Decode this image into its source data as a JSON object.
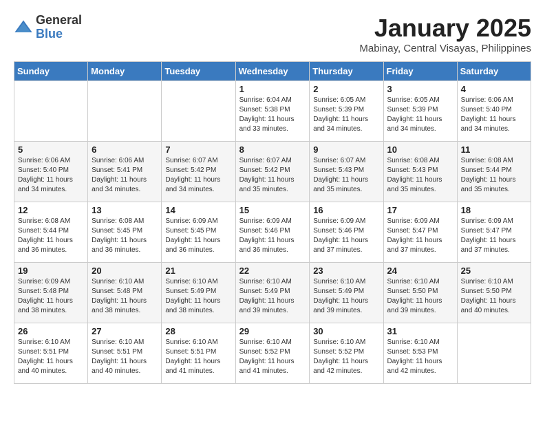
{
  "header": {
    "logo_general": "General",
    "logo_blue": "Blue",
    "title": "January 2025",
    "location": "Mabinay, Central Visayas, Philippines"
  },
  "weekdays": [
    "Sunday",
    "Monday",
    "Tuesday",
    "Wednesday",
    "Thursday",
    "Friday",
    "Saturday"
  ],
  "weeks": [
    [
      {
        "day": "",
        "info": ""
      },
      {
        "day": "",
        "info": ""
      },
      {
        "day": "",
        "info": ""
      },
      {
        "day": "1",
        "info": "Sunrise: 6:04 AM\nSunset: 5:38 PM\nDaylight: 11 hours\nand 33 minutes."
      },
      {
        "day": "2",
        "info": "Sunrise: 6:05 AM\nSunset: 5:39 PM\nDaylight: 11 hours\nand 34 minutes."
      },
      {
        "day": "3",
        "info": "Sunrise: 6:05 AM\nSunset: 5:39 PM\nDaylight: 11 hours\nand 34 minutes."
      },
      {
        "day": "4",
        "info": "Sunrise: 6:06 AM\nSunset: 5:40 PM\nDaylight: 11 hours\nand 34 minutes."
      }
    ],
    [
      {
        "day": "5",
        "info": "Sunrise: 6:06 AM\nSunset: 5:40 PM\nDaylight: 11 hours\nand 34 minutes."
      },
      {
        "day": "6",
        "info": "Sunrise: 6:06 AM\nSunset: 5:41 PM\nDaylight: 11 hours\nand 34 minutes."
      },
      {
        "day": "7",
        "info": "Sunrise: 6:07 AM\nSunset: 5:42 PM\nDaylight: 11 hours\nand 34 minutes."
      },
      {
        "day": "8",
        "info": "Sunrise: 6:07 AM\nSunset: 5:42 PM\nDaylight: 11 hours\nand 35 minutes."
      },
      {
        "day": "9",
        "info": "Sunrise: 6:07 AM\nSunset: 5:43 PM\nDaylight: 11 hours\nand 35 minutes."
      },
      {
        "day": "10",
        "info": "Sunrise: 6:08 AM\nSunset: 5:43 PM\nDaylight: 11 hours\nand 35 minutes."
      },
      {
        "day": "11",
        "info": "Sunrise: 6:08 AM\nSunset: 5:44 PM\nDaylight: 11 hours\nand 35 minutes."
      }
    ],
    [
      {
        "day": "12",
        "info": "Sunrise: 6:08 AM\nSunset: 5:44 PM\nDaylight: 11 hours\nand 36 minutes."
      },
      {
        "day": "13",
        "info": "Sunrise: 6:08 AM\nSunset: 5:45 PM\nDaylight: 11 hours\nand 36 minutes."
      },
      {
        "day": "14",
        "info": "Sunrise: 6:09 AM\nSunset: 5:45 PM\nDaylight: 11 hours\nand 36 minutes."
      },
      {
        "day": "15",
        "info": "Sunrise: 6:09 AM\nSunset: 5:46 PM\nDaylight: 11 hours\nand 36 minutes."
      },
      {
        "day": "16",
        "info": "Sunrise: 6:09 AM\nSunset: 5:46 PM\nDaylight: 11 hours\nand 37 minutes."
      },
      {
        "day": "17",
        "info": "Sunrise: 6:09 AM\nSunset: 5:47 PM\nDaylight: 11 hours\nand 37 minutes."
      },
      {
        "day": "18",
        "info": "Sunrise: 6:09 AM\nSunset: 5:47 PM\nDaylight: 11 hours\nand 37 minutes."
      }
    ],
    [
      {
        "day": "19",
        "info": "Sunrise: 6:09 AM\nSunset: 5:48 PM\nDaylight: 11 hours\nand 38 minutes."
      },
      {
        "day": "20",
        "info": "Sunrise: 6:10 AM\nSunset: 5:48 PM\nDaylight: 11 hours\nand 38 minutes."
      },
      {
        "day": "21",
        "info": "Sunrise: 6:10 AM\nSunset: 5:49 PM\nDaylight: 11 hours\nand 38 minutes."
      },
      {
        "day": "22",
        "info": "Sunrise: 6:10 AM\nSunset: 5:49 PM\nDaylight: 11 hours\nand 39 minutes."
      },
      {
        "day": "23",
        "info": "Sunrise: 6:10 AM\nSunset: 5:49 PM\nDaylight: 11 hours\nand 39 minutes."
      },
      {
        "day": "24",
        "info": "Sunrise: 6:10 AM\nSunset: 5:50 PM\nDaylight: 11 hours\nand 39 minutes."
      },
      {
        "day": "25",
        "info": "Sunrise: 6:10 AM\nSunset: 5:50 PM\nDaylight: 11 hours\nand 40 minutes."
      }
    ],
    [
      {
        "day": "26",
        "info": "Sunrise: 6:10 AM\nSunset: 5:51 PM\nDaylight: 11 hours\nand 40 minutes."
      },
      {
        "day": "27",
        "info": "Sunrise: 6:10 AM\nSunset: 5:51 PM\nDaylight: 11 hours\nand 40 minutes."
      },
      {
        "day": "28",
        "info": "Sunrise: 6:10 AM\nSunset: 5:51 PM\nDaylight: 11 hours\nand 41 minutes."
      },
      {
        "day": "29",
        "info": "Sunrise: 6:10 AM\nSunset: 5:52 PM\nDaylight: 11 hours\nand 41 minutes."
      },
      {
        "day": "30",
        "info": "Sunrise: 6:10 AM\nSunset: 5:52 PM\nDaylight: 11 hours\nand 42 minutes."
      },
      {
        "day": "31",
        "info": "Sunrise: 6:10 AM\nSunset: 5:53 PM\nDaylight: 11 hours\nand 42 minutes."
      },
      {
        "day": "",
        "info": ""
      }
    ]
  ]
}
